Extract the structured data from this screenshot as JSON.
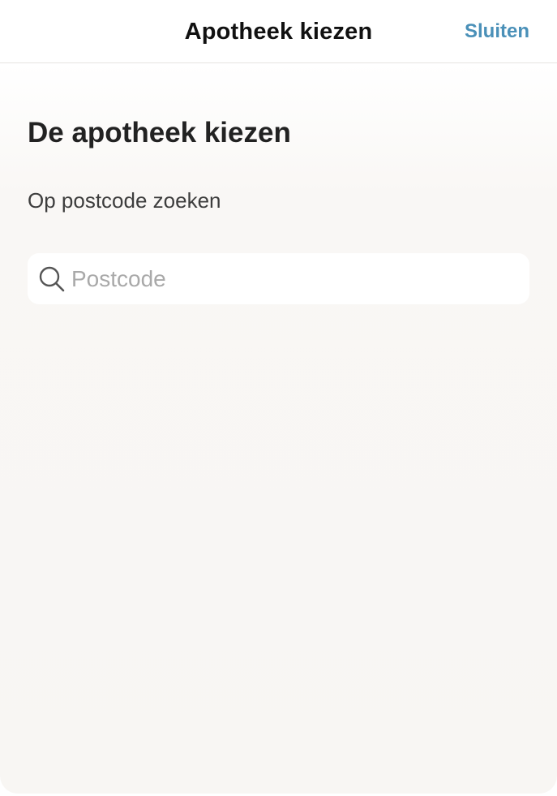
{
  "nav": {
    "title": "Apotheek kiezen",
    "close_label": "Sluiten"
  },
  "main": {
    "heading": "De apotheek kiezen",
    "search_label": "Op postcode zoeken",
    "search": {
      "value": "",
      "placeholder": "Postcode",
      "icon": "search-icon"
    }
  },
  "colors": {
    "accent": "#4a90b8",
    "background": "#f8f6f3",
    "text": "#222222"
  }
}
